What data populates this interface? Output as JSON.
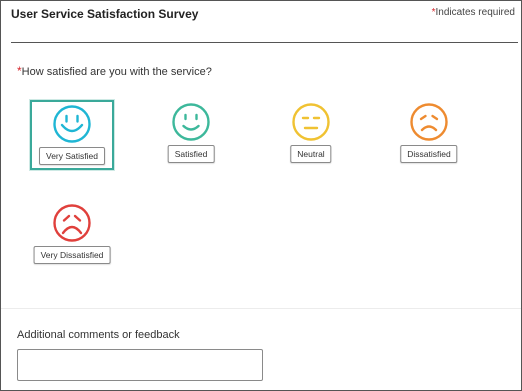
{
  "header": {
    "title": "User Service Satisfaction Survey",
    "required_star": "*",
    "required_note": "Indicates required"
  },
  "question": {
    "required_star": "*",
    "text": "How satisfied are you with the service?"
  },
  "options": [
    {
      "label": "Very Satisfied",
      "icon": "very-satisfied-face-icon",
      "color": "#1fb6d4",
      "selected": true
    },
    {
      "label": "Satisfied",
      "icon": "satisfied-face-icon",
      "color": "#3db89b",
      "selected": false
    },
    {
      "label": "Neutral",
      "icon": "neutral-face-icon",
      "color": "#f0c232",
      "selected": false
    },
    {
      "label": "Dissatisfied",
      "icon": "dissatisfied-face-icon",
      "color": "#ee8b30",
      "selected": false
    },
    {
      "label": "Very Dissatisfied",
      "icon": "very-dissatisfied-face-icon",
      "color": "#e0403c",
      "selected": false
    }
  ],
  "comments": {
    "label": "Additional comments or feedback",
    "value": "",
    "placeholder": ""
  },
  "colors": {
    "selected_border": "#3aa99a",
    "required_star": "#d6262c"
  }
}
